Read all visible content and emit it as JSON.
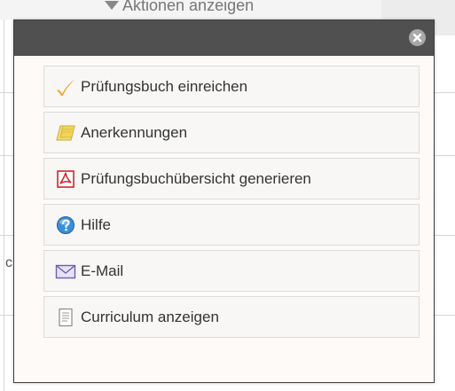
{
  "background": {
    "action_label": "Aktionen anzeigen",
    "partial_letter": "c"
  },
  "popup": {
    "close_icon": "close-icon",
    "items": [
      {
        "label": "Prüfungsbuch einreichen",
        "icon": "checkmark-icon",
        "color": "#f39a1e"
      },
      {
        "label": "Anerkennungen",
        "icon": "folder-icon",
        "color": "#f2d45a"
      },
      {
        "label": "Prüfungsbuchübersicht generieren",
        "icon": "pdf-icon",
        "color": "#d2232a"
      },
      {
        "label": "Hilfe",
        "icon": "help-icon",
        "color": "#3b8fd8"
      },
      {
        "label": "E-Mail",
        "icon": "envelope-icon",
        "color": "#6d5fb0"
      },
      {
        "label": "Curriculum anzeigen",
        "icon": "document-icon",
        "color": "#8a8a8a"
      }
    ]
  }
}
